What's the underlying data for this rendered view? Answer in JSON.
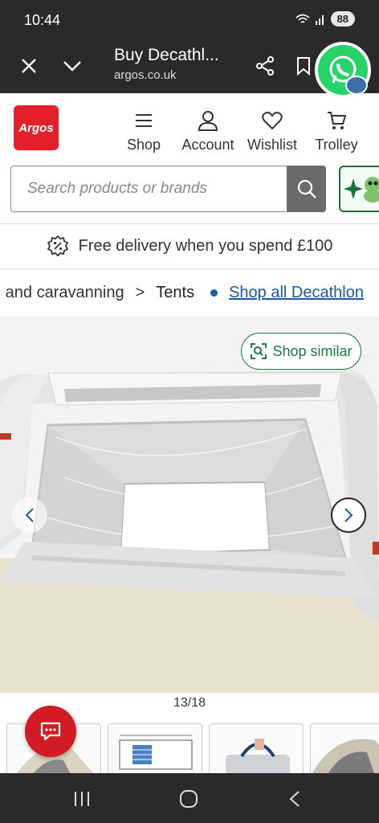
{
  "status": {
    "time": "10:44",
    "battery": "88"
  },
  "browser": {
    "title": "Buy Decathl...",
    "url": "argos.co.uk"
  },
  "header": {
    "logo": "Argos",
    "nav": [
      {
        "label": "Shop",
        "icon": "menu-icon"
      },
      {
        "label": "Account",
        "icon": "account-icon"
      },
      {
        "label": "Wishlist",
        "icon": "heart-icon"
      },
      {
        "label": "Trolley",
        "icon": "trolley-icon"
      }
    ]
  },
  "search": {
    "placeholder": "Search products or brands"
  },
  "delivery": {
    "text": "Free delivery when you spend £100"
  },
  "breadcrumb": {
    "items": [
      "g and caravanning",
      "Tents"
    ],
    "link": "Shop all Decathlon"
  },
  "gallery": {
    "shop_similar": "Shop similar",
    "counter": "13/18"
  },
  "colors": {
    "brand_red": "#e3202b",
    "link_blue": "#1a5aa6",
    "green": "#1d7a45"
  }
}
